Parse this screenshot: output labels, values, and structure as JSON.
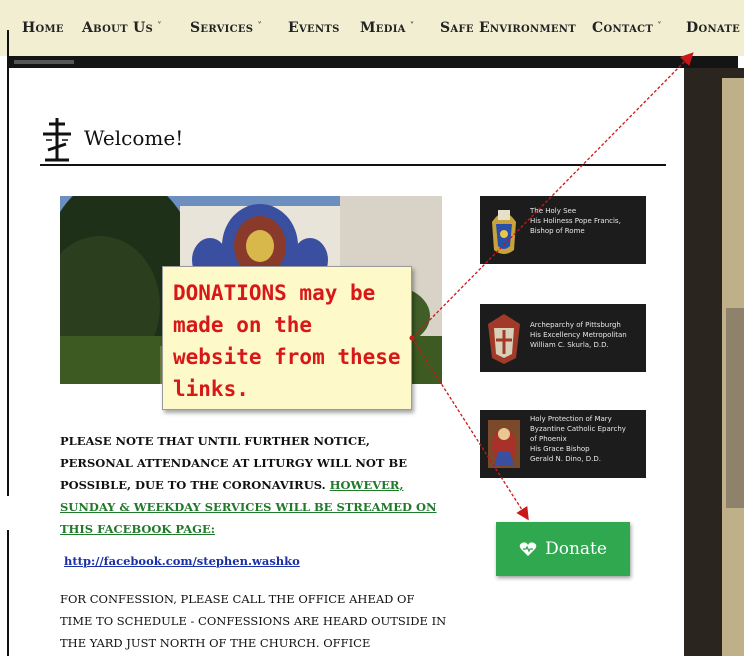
{
  "nav": {
    "items": [
      {
        "label": "Home",
        "has_dropdown": false
      },
      {
        "label": "About Us",
        "has_dropdown": true
      },
      {
        "label": "Services",
        "has_dropdown": true
      },
      {
        "label": "Events",
        "has_dropdown": false
      },
      {
        "label": "Media",
        "has_dropdown": true
      },
      {
        "label": "Safe Environment",
        "has_dropdown": false
      },
      {
        "label": "Contact",
        "has_dropdown": true
      },
      {
        "label": "Donate",
        "has_dropdown": false
      }
    ],
    "chevron": "˅"
  },
  "welcome": {
    "title": "Welcome!",
    "icon": "orthodox-cross-icon"
  },
  "sidebar": {
    "boxes": [
      {
        "lines": [
          "The Holy See",
          "His Holiness Pope Francis,",
          "Bishop of Rome"
        ],
        "icon": "papal-crest-icon"
      },
      {
        "lines": [
          "Archeparchy of Pittsburgh",
          "His Excellency Metropolitan",
          "William C. Skurla, D.D."
        ],
        "icon": "archeparchy-crest-icon"
      },
      {
        "lines": [
          "Holy Protection of Mary",
          "Byzantine Catholic Eparchy",
          "of Phoenix",
          "His Grace Bishop",
          "Gerald N. Dino, D.D."
        ],
        "icon": "eparchy-crest-icon"
      }
    ]
  },
  "donate_button": {
    "label": "Donate",
    "icon": "heart-icon"
  },
  "notice": {
    "part1": "Please note that until further notice, personal attendance at Liturgy will not be possible, due to the Coronavirus.",
    "part2": "However, Sunday & weekday services will be streamed on this Facebook page:"
  },
  "facebook_link": "http://facebook.com/stephen.washko",
  "confession": "For confession, please call the office ahead of time to schedule - confessions are heard outside in the yard just north of the church. Office",
  "callout": {
    "text": "DONATIONS may be made on the website from these links."
  },
  "colors": {
    "callout_text": "#d81818",
    "donate_green": "#2fa84f",
    "nav_bg": "#f1eed2",
    "link_blue": "#1a2fa8"
  }
}
